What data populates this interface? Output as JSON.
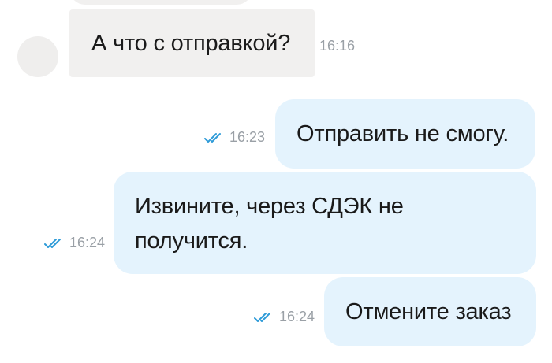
{
  "messages": [
    {
      "direction": "incoming",
      "text": "А что с отправкой?",
      "time": "16:16"
    },
    {
      "direction": "outgoing",
      "text": "Отправить не смогу.",
      "time": "16:23",
      "status": "read"
    },
    {
      "direction": "outgoing",
      "lines": [
        "Извините, через СДЭК не",
        "получится."
      ],
      "time": "16:24",
      "status": "read"
    },
    {
      "direction": "outgoing",
      "text": "Отмените заказ",
      "time": "16:24",
      "status": "read"
    }
  ],
  "colors": {
    "incoming_bubble": "#f1f0ef",
    "outgoing_bubble": "#e4f3fd",
    "avatar": "#efeeed",
    "read_checks": "#2e9bd8",
    "timestamp": "#9aa0a6"
  },
  "icons": {
    "read_status": "double-check-icon"
  }
}
